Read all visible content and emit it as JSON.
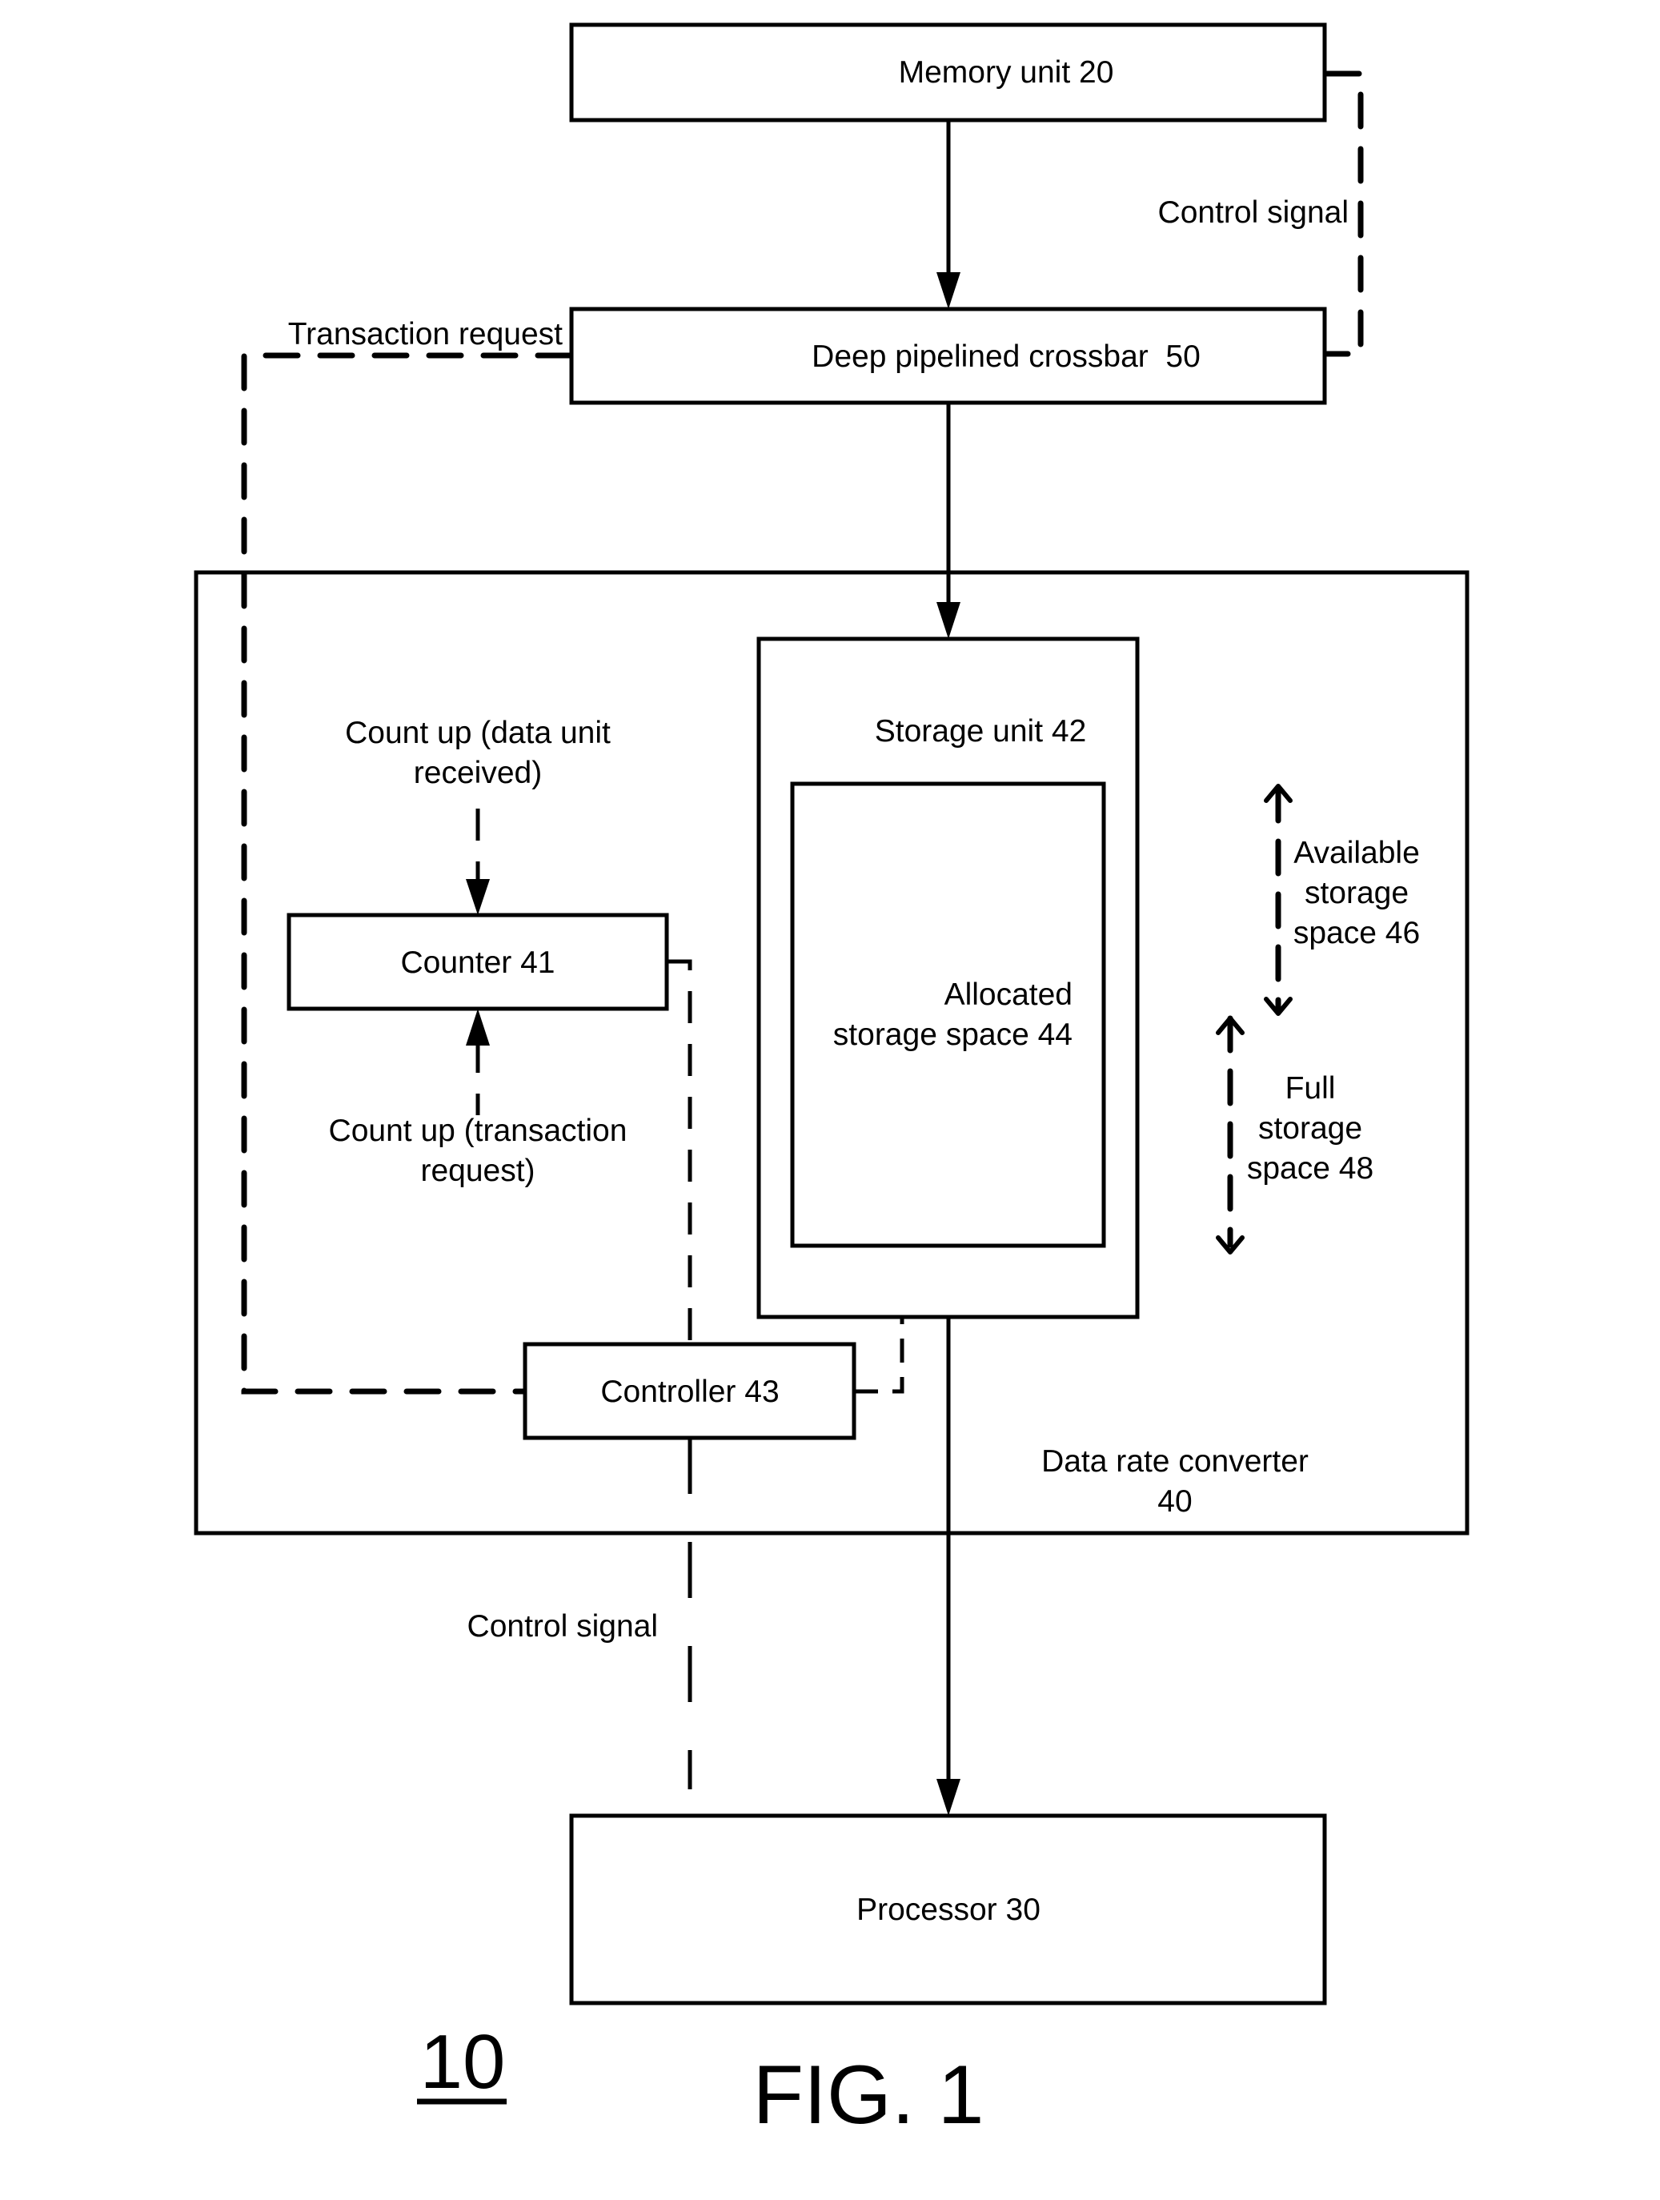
{
  "figure": {
    "title": "FIG. 1",
    "reference_numeral": "10"
  },
  "blocks": {
    "memory_unit": "Memory unit 20",
    "crossbar": "Deep pipelined crossbar  50",
    "data_rate_converter": [
      "Data rate converter",
      "40"
    ],
    "storage_unit": "Storage unit 42",
    "allocated_storage": [
      "Allocated",
      "storage space 44"
    ],
    "counter": "Counter 41",
    "controller": "Controller 43",
    "processor": "Processor 30"
  },
  "labels": {
    "control_signal_top": "Control signal",
    "transaction_request": "Transaction request",
    "count_up_data": [
      "Count up (data unit",
      "received)"
    ],
    "count_up_transaction": [
      "Count up (transaction",
      "request)"
    ],
    "available_storage": [
      "Available",
      "storage",
      "space 46"
    ],
    "full_storage": [
      "Full",
      "storage",
      "space 48"
    ],
    "control_signal_bottom": "Control signal"
  }
}
